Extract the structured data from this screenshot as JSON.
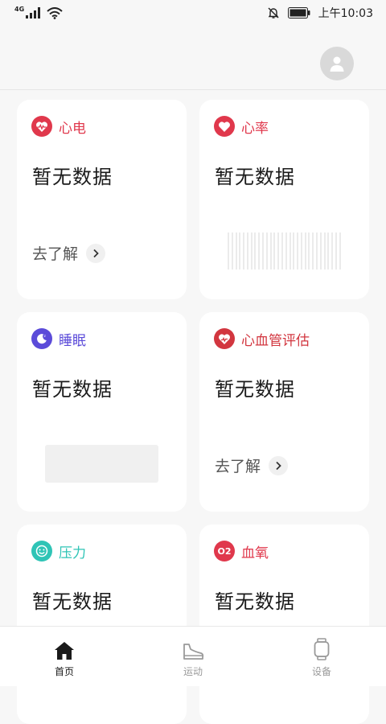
{
  "status_bar": {
    "network": "4G",
    "time": "上午10:03"
  },
  "colors": {
    "ecg": "#e0384c",
    "heart_rate": "#e0384c",
    "sleep": "#5b4bd9",
    "cardio": "#d2363f",
    "stress": "#2fc4b6",
    "spo2": "#e0384c",
    "tab_active": "#1a1a1a",
    "tab_inactive": "#9a9a9a"
  },
  "cards": [
    {
      "title": "心电",
      "icon": "ecg-heart-icon",
      "value": "暂无数据",
      "learn": "去了解"
    },
    {
      "title": "心率",
      "icon": "heart-icon",
      "value": "暂无数据"
    },
    {
      "title": "睡眠",
      "icon": "moon-icon",
      "value": "暂无数据"
    },
    {
      "title": "心血管评估",
      "icon": "heart-pulse-icon",
      "value": "暂无数据",
      "learn": "去了解"
    },
    {
      "title": "压力",
      "icon": "smile-icon",
      "value": "暂无数据"
    },
    {
      "title": "血氧",
      "icon": "o2-icon",
      "value": "暂无数据",
      "icon_text": "O2"
    }
  ],
  "tabs": [
    {
      "label": "首页",
      "icon": "home-icon",
      "active": true
    },
    {
      "label": "运动",
      "icon": "shoe-icon",
      "active": false
    },
    {
      "label": "设备",
      "icon": "watch-icon",
      "active": false
    }
  ]
}
